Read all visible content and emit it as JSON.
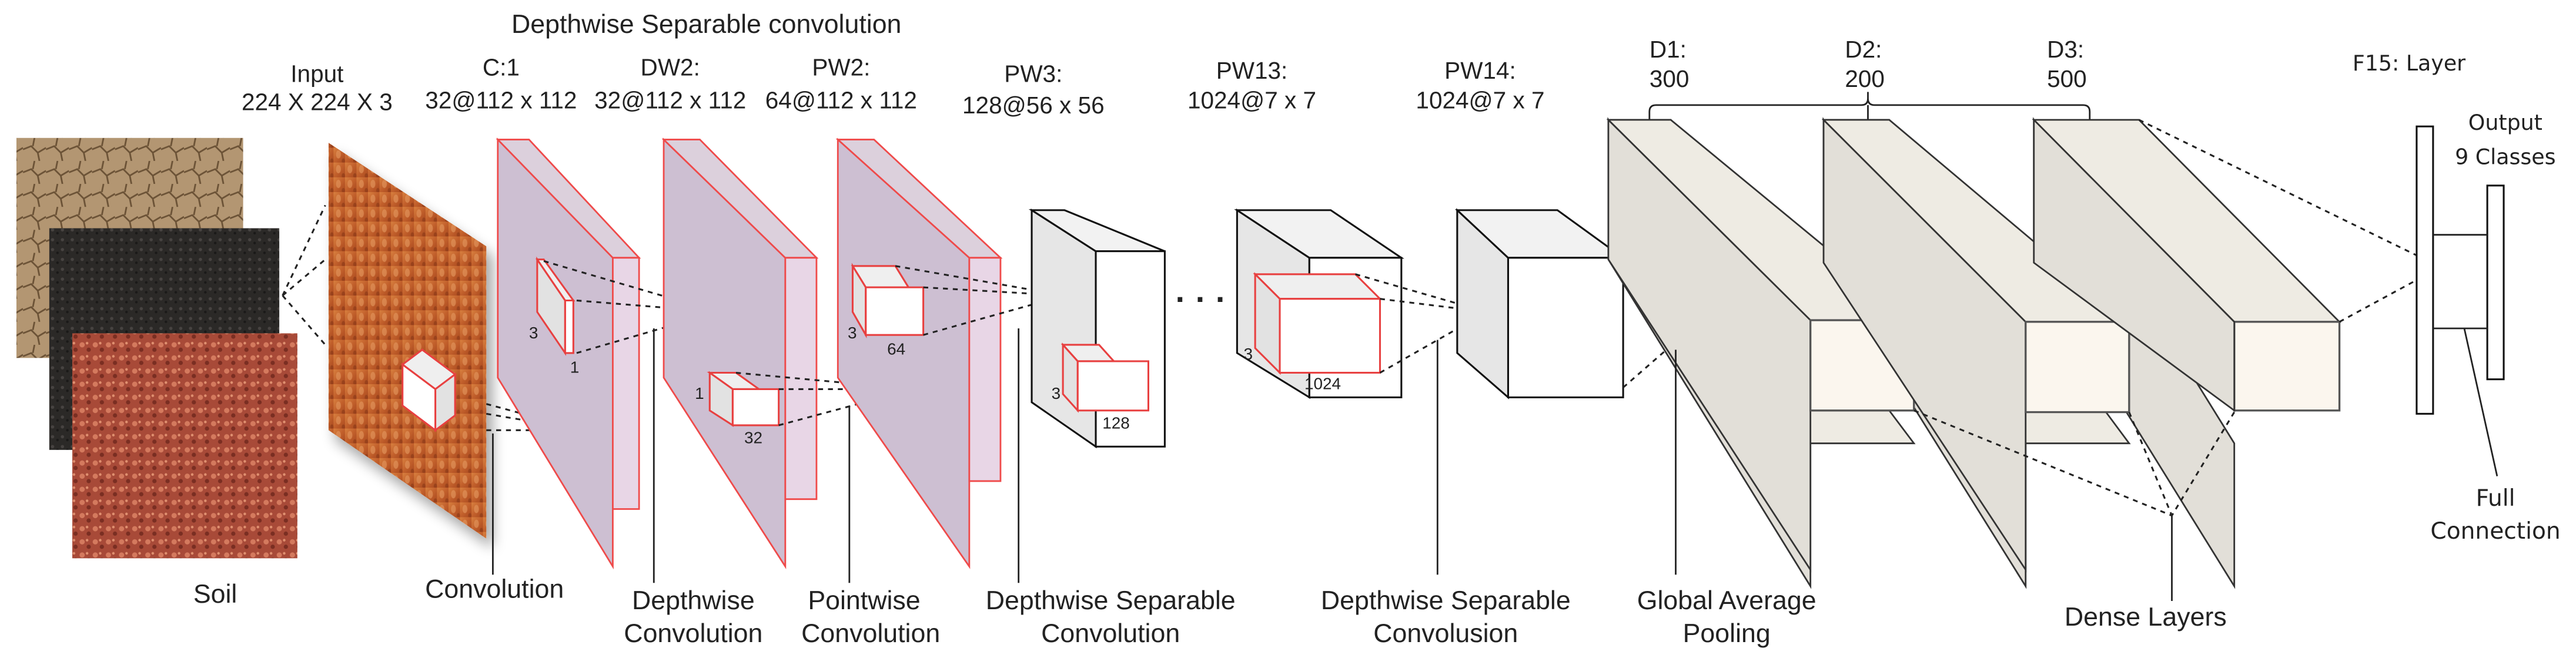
{
  "title": "Depthwise Separable convolution",
  "layers": {
    "input": {
      "name": "Input",
      "dims": "224 X 224 X 3"
    },
    "c1": {
      "name": "C:1",
      "dims": "32@112 x 112"
    },
    "dw2": {
      "name": "DW2:",
      "dims": "32@112 x 112"
    },
    "pw2": {
      "name": "PW2:",
      "dims": "64@112 x 112"
    },
    "pw3": {
      "name": "PW3:",
      "dims": "128@56 x 56"
    },
    "pw13": {
      "name": "PW13:",
      "dims": "1024@7 x 7"
    },
    "pw14": {
      "name": "PW14:",
      "dims": "1024@7 x 7"
    },
    "d1": {
      "name": "D1:",
      "dims": "300"
    },
    "d2": {
      "name": "D2:",
      "dims": "200"
    },
    "d3": {
      "name": "D3:",
      "dims": "500"
    },
    "f15": {
      "name": "F15: Layer"
    },
    "output": {
      "line1": "Output",
      "line2": "9 Classes"
    }
  },
  "kernels": {
    "c1": {
      "h": "3",
      "w": "1"
    },
    "dw2": {
      "h": "1",
      "w": "32"
    },
    "pw2": {
      "h": "3",
      "w": "64"
    },
    "pw3": {
      "h": "3",
      "w": "128"
    },
    "pw13": {
      "h": "3",
      "w": "1024"
    }
  },
  "ellipsis": "· · ·",
  "captions": {
    "soil": "Soil",
    "convolution": "Convolution",
    "depthwise": {
      "line1": "Depthwise",
      "line2": "Convolution"
    },
    "pointwise": {
      "line1": "Pointwise",
      "line2": "Convolution"
    },
    "dsc1": {
      "line1": "Depthwise Separable",
      "line2": "Convolution"
    },
    "dsc2": {
      "line1": "Depthwise Separable",
      "line2": "Convolusion"
    },
    "gap": {
      "line1": "Global Average",
      "line2": "Pooling"
    },
    "dense": "Dense Layers",
    "fc": {
      "line1": "Full",
      "line2": "Connection"
    }
  },
  "colors": {
    "feature_map_border": "#ef4a4a",
    "feature_map_fill": "#cdbfd2",
    "dense_fill": "#eeebe3",
    "soil_dry": "#a88a64",
    "soil_black": "#2a2826",
    "soil_red": "#b0503c",
    "input_texture": "#c8612e"
  }
}
